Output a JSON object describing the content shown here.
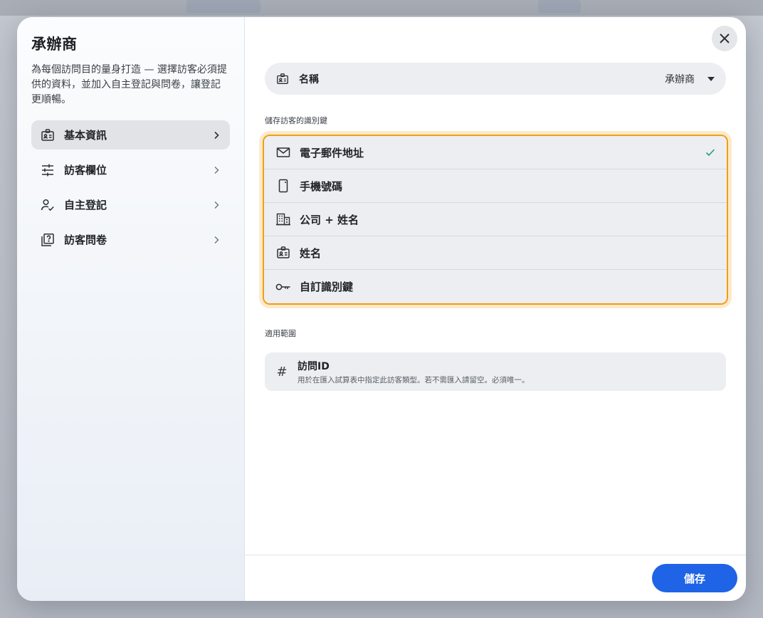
{
  "sidebar": {
    "title": "承辦商",
    "description": "為每個訪問目的量身打造 — 選擇訪客必須提供的資料，並加入自主登記與問卷，讓登記更順暢。",
    "items": [
      {
        "label": "基本資訊",
        "icon": "id-badge-icon",
        "active": true
      },
      {
        "label": "訪客欄位",
        "icon": "sliders-icon",
        "active": false
      },
      {
        "label": "自主登記",
        "icon": "person-check-icon",
        "active": false
      },
      {
        "label": "訪客問卷",
        "icon": "questionnaire-icon",
        "active": false
      }
    ]
  },
  "name_field": {
    "label": "名稱",
    "value": "承辦商"
  },
  "identifier": {
    "title": "儲存訪客的識別鍵",
    "options": [
      {
        "label": "電子郵件地址",
        "icon": "mail-icon",
        "selected": true
      },
      {
        "label": "手機號碼",
        "icon": "phone-icon",
        "selected": false
      },
      {
        "label": "公司 + 姓名",
        "icon": "building-icon",
        "selected": false
      },
      {
        "label": "姓名",
        "icon": "id-badge-icon",
        "selected": false
      },
      {
        "label": "自訂識別鍵",
        "icon": "key-icon",
        "selected": false
      }
    ]
  },
  "scope": {
    "title": "適用範圍",
    "field_label": "訪問ID",
    "field_help": "用於在匯入試算表中指定此訪客類型。若不需匯入請留空。必須唯一。"
  },
  "footer": {
    "save_label": "儲存"
  },
  "colors": {
    "accent": "#1f63e6",
    "highlight": "#f29d12",
    "check": "#2a9d6a"
  }
}
